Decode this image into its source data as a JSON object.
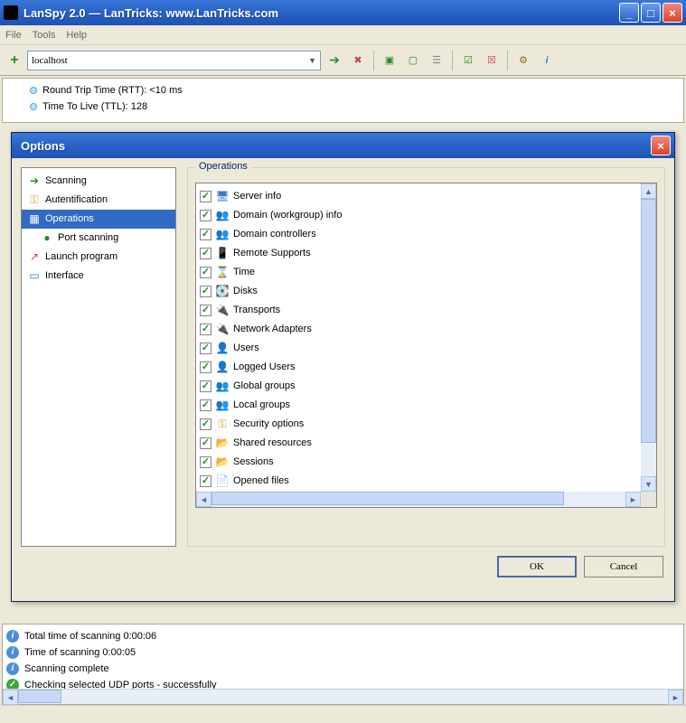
{
  "window": {
    "title": "LanSpy 2.0 — LanTricks: www.LanTricks.com"
  },
  "menu": {
    "file": "File",
    "tools": "Tools",
    "help": "Help"
  },
  "toolbar": {
    "address": "localhost"
  },
  "tree": {
    "rtt": "Round Trip Time (RTT): <10 ms",
    "ttl": "Time To Live (TTL): 128"
  },
  "log": {
    "l1": "Total time of scanning 0:00:06",
    "l2": "Time of scanning 0:00:05",
    "l3": "Scanning complete",
    "l4": "Checking selected UDP ports - successfully"
  },
  "dialog": {
    "title": "Options",
    "nav": {
      "scanning": "Scanning",
      "auth": "Autentification",
      "operations": "Operations",
      "portscan": "Port scanning",
      "launch": "Launch program",
      "interface": "Interface"
    },
    "group_label": "Operations",
    "ops": [
      "Server info",
      "Domain (workgroup) info",
      "Domain controllers",
      "Remote Supports",
      "Time",
      "Disks",
      "Transports",
      "Network Adapters",
      "Users",
      "Logged Users",
      "Global groups",
      "Local groups",
      "Security options",
      "Shared resources",
      "Sessions",
      "Opened files"
    ],
    "ok": "OK",
    "cancel": "Cancel"
  }
}
